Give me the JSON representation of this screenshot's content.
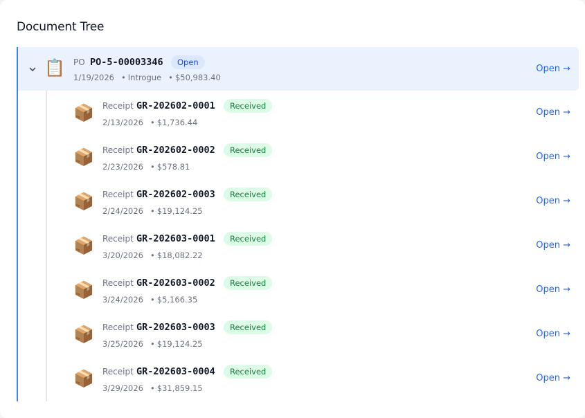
{
  "panel": {
    "title": "Document Tree"
  },
  "parent": {
    "type_label": "PO",
    "number": "PO-5-00003346",
    "status": "Open",
    "date": "1/19/2026",
    "vendor": "Introgue",
    "amount": "$50,983.40",
    "link": "Open →",
    "icon": "clipboard-icon",
    "icon_glyph": "📋"
  },
  "children": [
    {
      "type_label": "Receipt",
      "number": "GR-202602-0001",
      "status": "Received",
      "date": "2/13/2026",
      "amount": "$1,736.44",
      "link": "Open →",
      "icon_glyph": "📦"
    },
    {
      "type_label": "Receipt",
      "number": "GR-202602-0002",
      "status": "Received",
      "date": "2/23/2026",
      "amount": "$578.81",
      "link": "Open →",
      "icon_glyph": "📦"
    },
    {
      "type_label": "Receipt",
      "number": "GR-202602-0003",
      "status": "Received",
      "date": "2/24/2026",
      "amount": "$19,124.25",
      "link": "Open →",
      "icon_glyph": "📦"
    },
    {
      "type_label": "Receipt",
      "number": "GR-202603-0001",
      "status": "Received",
      "date": "3/20/2026",
      "amount": "$18,082.22",
      "link": "Open →",
      "icon_glyph": "📦"
    },
    {
      "type_label": "Receipt",
      "number": "GR-202603-0002",
      "status": "Received",
      "date": "3/24/2026",
      "amount": "$5,166.35",
      "link": "Open →",
      "icon_glyph": "📦"
    },
    {
      "type_label": "Receipt",
      "number": "GR-202603-0003",
      "status": "Received",
      "date": "3/25/2026",
      "amount": "$19,124.25",
      "link": "Open →",
      "icon_glyph": "📦"
    },
    {
      "type_label": "Receipt",
      "number": "GR-202603-0004",
      "status": "Received",
      "date": "3/29/2026",
      "amount": "$31,859.15",
      "link": "Open →",
      "icon_glyph": "📦"
    }
  ],
  "colors": {
    "accent": "#3b82f6",
    "link": "#2563eb",
    "received_bg": "#dcfce7",
    "received_text": "#15803d",
    "open_bg": "#dbe7fb",
    "selected_row": "#eaf2fd"
  }
}
